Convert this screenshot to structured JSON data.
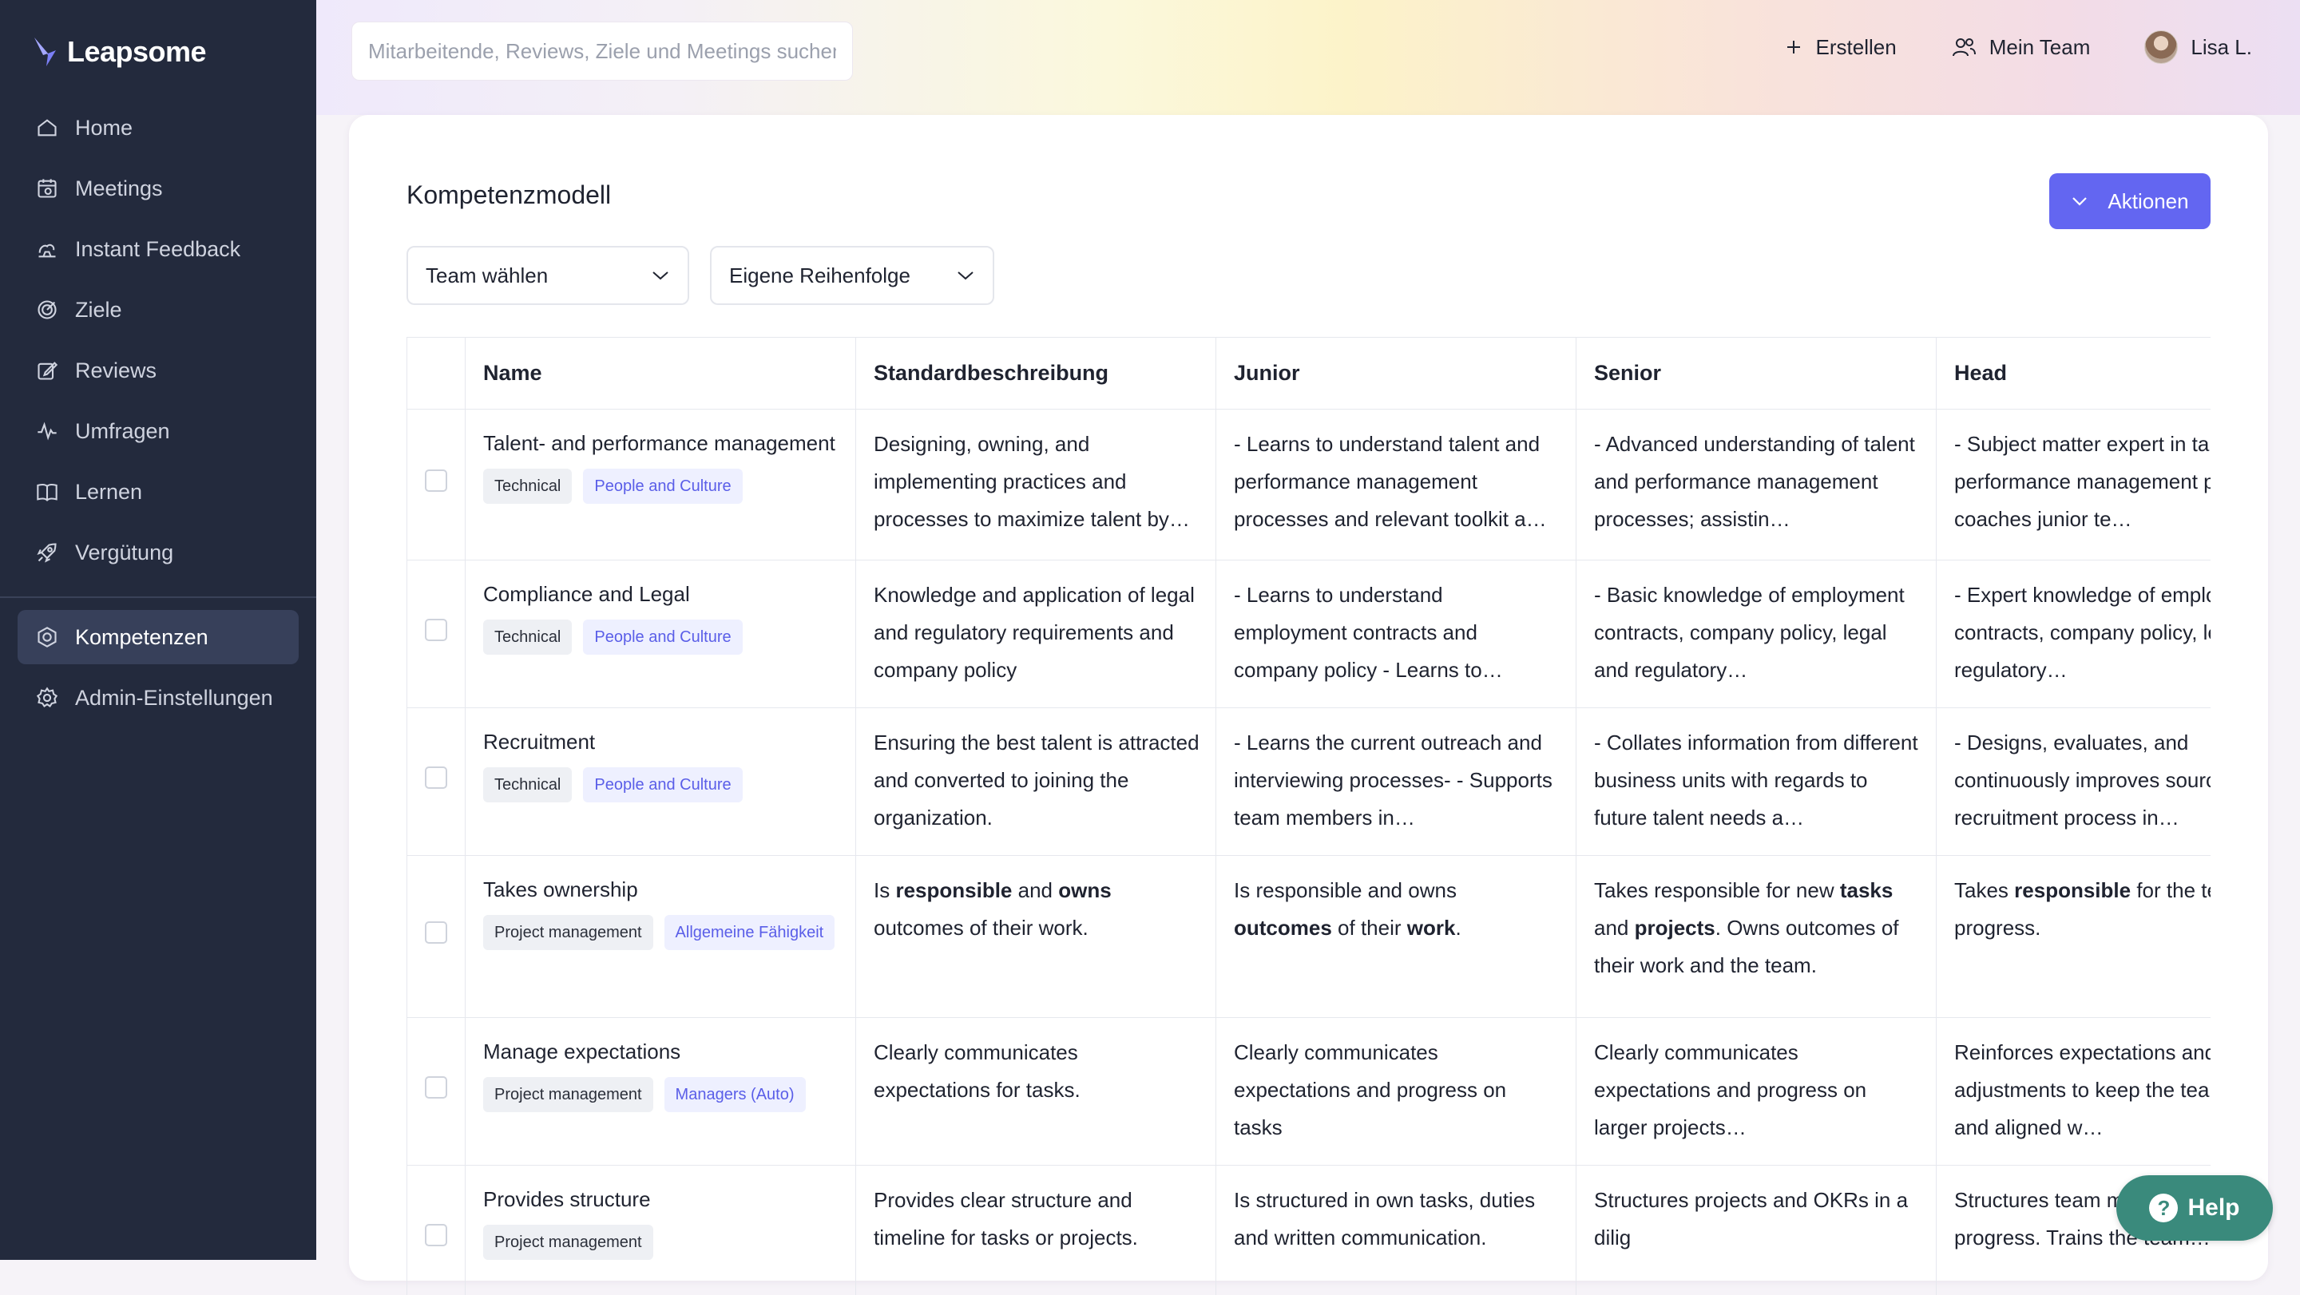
{
  "sidebar": {
    "brand": "Leapsome",
    "items": [
      {
        "label": "Home",
        "icon": "home-icon"
      },
      {
        "label": "Meetings",
        "icon": "meetings-icon"
      },
      {
        "label": "Instant Feedback",
        "icon": "feedback-icon"
      },
      {
        "label": "Ziele",
        "icon": "target-icon"
      },
      {
        "label": "Reviews",
        "icon": "edit-icon"
      },
      {
        "label": "Umfragen",
        "icon": "pulse-icon"
      },
      {
        "label": "Lernen",
        "icon": "book-icon"
      },
      {
        "label": "Vergütung",
        "icon": "rocket-icon"
      }
    ],
    "items2": [
      {
        "label": "Kompetenzen",
        "icon": "competency-icon",
        "active": true
      },
      {
        "label": "Admin-Einstellungen",
        "icon": "gear-icon"
      }
    ]
  },
  "topbar": {
    "search_placeholder": "Mitarbeitende, Reviews, Ziele und Meetings suchen",
    "create_label": "Erstellen",
    "team_label": "Mein Team",
    "user_label": "Lisa L."
  },
  "main": {
    "title": "Kompetenzmodell",
    "actions_label": "Aktionen",
    "team_select": "Team wählen",
    "order_select": "Eigene Reihenfolge"
  },
  "table": {
    "columns": [
      "Name",
      "Standardbeschreibung",
      "Junior",
      "Senior",
      "Head"
    ],
    "rows": [
      {
        "name": "Talent- and performance management",
        "tags": [
          {
            "label": "Technical",
            "style": "gray"
          },
          {
            "label": "People and Culture",
            "style": "purple"
          }
        ],
        "standard": "Designing, owning, and implementing practices and processes to maximize talent by…",
        "junior": "- Learns to understand talent and performance management processes and relevant toolkit a…",
        "senior": "- Advanced understanding of talent and performance management processes; assistin…",
        "head": "- Subject matter expert in talent and performance management processes coaches junior te…"
      },
      {
        "name": "Compliance and Legal",
        "tags": [
          {
            "label": "Technical",
            "style": "gray"
          },
          {
            "label": "People and Culture",
            "style": "purple"
          }
        ],
        "standard": "Knowledge and application of legal and regulatory requirements and company policy",
        "junior": "- Learns to understand employment contracts and company policy - Learns to…",
        "senior": "- Basic knowledge of employment contracts, company policy, legal and regulatory…",
        "head": "- Expert knowledge of employment contracts, company policy, legal and regulatory…"
      },
      {
        "name": "Recruitment",
        "tags": [
          {
            "label": "Technical",
            "style": "gray"
          },
          {
            "label": "People and Culture",
            "style": "purple"
          }
        ],
        "standard": "Ensuring the best talent is attracted and converted to joining the organization.",
        "junior": "- Learns the current outreach and interviewing processes- - Supports team members in…",
        "senior": "- Collates information from different business units with regards to future talent needs a…",
        "head": "- Designs, evaluates, and continuously improves sourcing and recruitment process in…"
      },
      {
        "name": "Takes ownership",
        "tags": [
          {
            "label": "Project management",
            "style": "gray"
          },
          {
            "label": "Allgemeine Fähigkeit",
            "style": "purple"
          }
        ],
        "standard_parts": [
          {
            "t": "Is "
          },
          {
            "t": "responsible",
            "b": true
          },
          {
            "t": " and "
          },
          {
            "t": "owns",
            "b": true
          },
          {
            "t": " outcomes of their work."
          }
        ],
        "junior_parts": [
          {
            "t": "Is responsible and owns "
          },
          {
            "t": "outcomes",
            "b": true
          },
          {
            "t": " of their "
          },
          {
            "t": "work",
            "b": true
          },
          {
            "t": "."
          }
        ],
        "senior_parts": [
          {
            "t": "Takes responsible for new "
          },
          {
            "t": "tasks",
            "b": true
          },
          {
            "t": " and "
          },
          {
            "t": "projects",
            "b": true
          },
          {
            "t": ". Owns outcomes of their work and the team."
          }
        ],
        "head_parts": [
          {
            "t": "Takes "
          },
          {
            "t": "responsible",
            "b": true
          },
          {
            "t": " for the team's progress."
          }
        ]
      },
      {
        "name": "Manage expectations",
        "tags": [
          {
            "label": "Project management",
            "style": "gray"
          },
          {
            "label": "Managers (Auto)",
            "style": "purple"
          }
        ],
        "standard": "Clearly communicates expectations for tasks.",
        "junior": "Clearly communicates expectations and progress on tasks",
        "senior": "Clearly communicates expectations and progress on larger projects…",
        "head": "Reinforces expectations and makes adjustments to keep the team on track and aligned w…"
      },
      {
        "name": "Provides structure",
        "tags": [
          {
            "label": "Project management",
            "style": "gray"
          }
        ],
        "standard": "Provides clear structure and timeline for tasks or projects.",
        "junior": "Is structured in own tasks, duties and written communication.",
        "senior": "Structures projects and OKRs in a dilig",
        "head": "Structures team members and team progress. Trains the team…"
      }
    ]
  },
  "help_label": "Help"
}
